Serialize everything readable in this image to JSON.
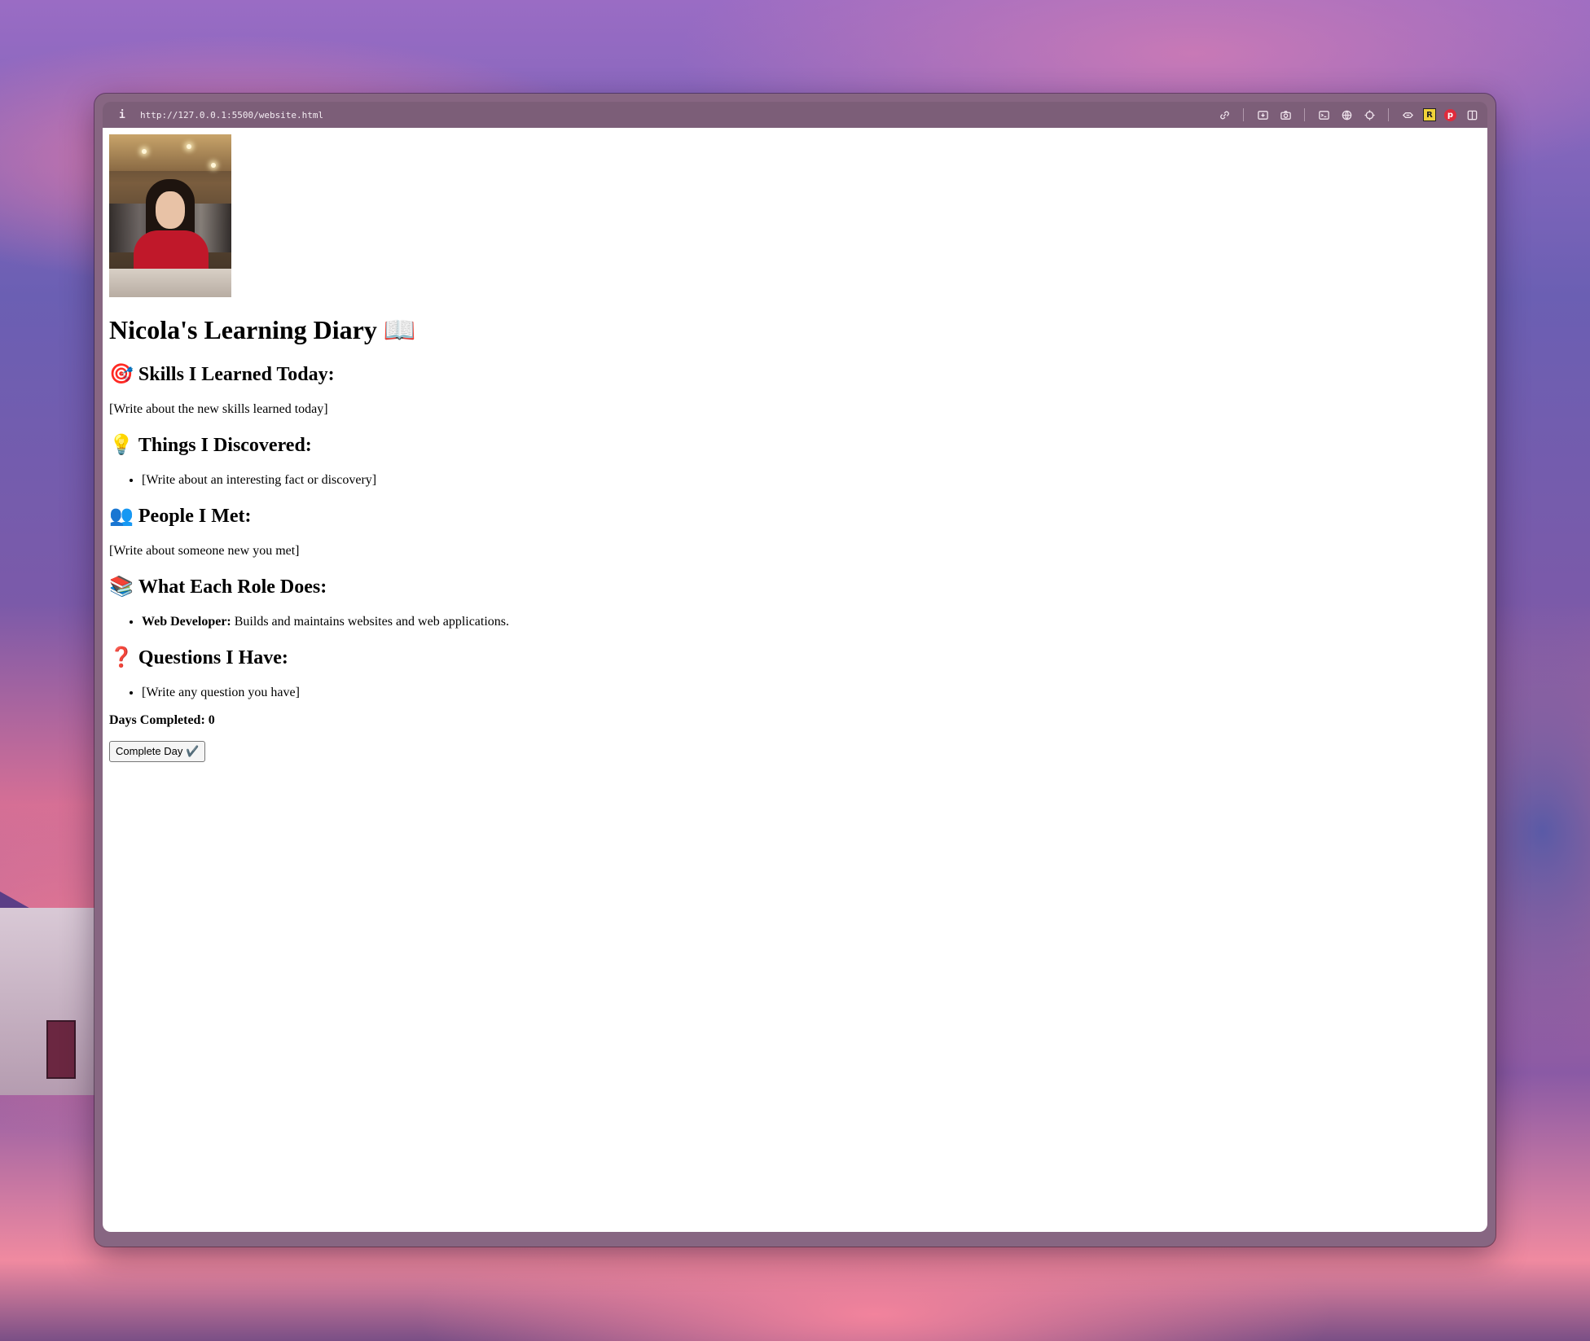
{
  "browser": {
    "info_icon": "i",
    "url": "http://127.0.0.1:5500/website.html",
    "toolbar_icons": [
      "link-icon",
      "screenshot-icon",
      "camera-icon",
      "terminal-icon",
      "globe-icon",
      "crosshair-icon",
      "extension-icon",
      "r-badge-icon",
      "pinterest-icon",
      "split-view-icon"
    ],
    "r_badge": "R",
    "p_badge": "p"
  },
  "page": {
    "title": "Nicola's Learning Diary",
    "title_emoji": "📖",
    "sections": {
      "skills": {
        "emoji": "🎯",
        "heading": "Skills I Learned Today:",
        "text": "[Write about the new skills learned today]"
      },
      "discovered": {
        "emoji": "💡",
        "heading": "Things I Discovered:",
        "item": "[Write about an interesting fact or discovery]"
      },
      "people": {
        "emoji": "👥",
        "heading": "People I Met:",
        "text": "[Write about someone new you met]"
      },
      "roles": {
        "emoji": "📚",
        "heading": "What Each Role Does:",
        "role_name": "Web Developer:",
        "role_desc": "Builds and maintains websites and web applications."
      },
      "questions": {
        "emoji": "❓",
        "heading": "Questions I Have:",
        "item": "[Write any question you have]"
      }
    },
    "days_completed_label": "Days Completed:",
    "days_completed_value": "0",
    "complete_button": "Complete Day ✔️"
  }
}
